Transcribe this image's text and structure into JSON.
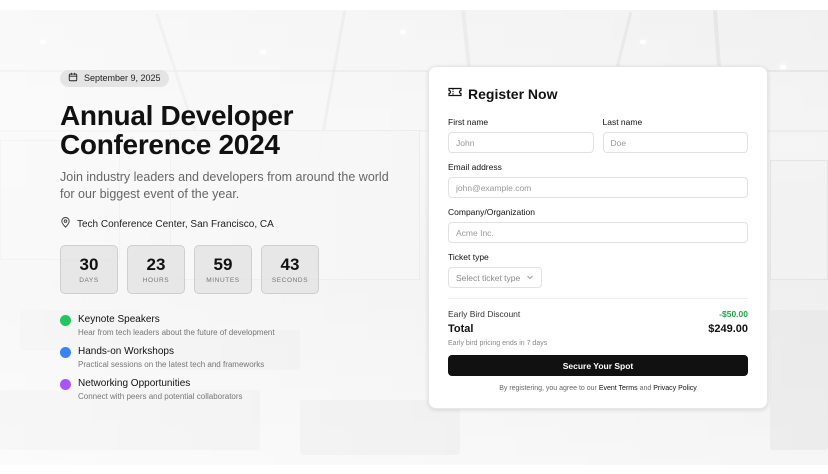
{
  "event": {
    "date": "September 9, 2025",
    "title_line1": "Annual Developer",
    "title_line2": "Conference 2024",
    "subtitle": "Join industry leaders and developers from around the world for our biggest event of the year.",
    "location": "Tech Conference Center, San Francisco, CA"
  },
  "countdown": [
    {
      "value": "30",
      "label": "DAYS"
    },
    {
      "value": "23",
      "label": "HOURS"
    },
    {
      "value": "59",
      "label": "MINUTES"
    },
    {
      "value": "43",
      "label": "SECONDS"
    }
  ],
  "features": [
    {
      "title": "Keynote Speakers",
      "desc": "Hear from tech leaders about the future of development",
      "color": "#22c55e"
    },
    {
      "title": "Hands-on Workshops",
      "desc": "Practical sessions on the latest tech and frameworks",
      "color": "#3b82f6"
    },
    {
      "title": "Networking Opportunities",
      "desc": "Connect with peers and potential collaborators",
      "color": "#a855f7"
    }
  ],
  "form": {
    "title": "Register Now",
    "first_name": {
      "label": "First name",
      "placeholder": "John",
      "value": ""
    },
    "last_name": {
      "label": "Last name",
      "placeholder": "Doe",
      "value": ""
    },
    "email": {
      "label": "Email address",
      "placeholder": "john@example.com",
      "value": ""
    },
    "company": {
      "label": "Company/Organization",
      "placeholder": "Acme Inc.",
      "value": ""
    },
    "ticket": {
      "label": "Ticket type",
      "placeholder": "Select ticket type"
    },
    "discount_label": "Early Bird Discount",
    "discount_value": "-$50.00",
    "total_label": "Total",
    "total_value": "$249.00",
    "note": "Early bird pricing ends in 7 days",
    "submit": "Secure Your Spot",
    "terms_prefix": "By registering, you agree to our",
    "terms_link": "Event Terms",
    "terms_and": "and",
    "privacy_link": "Privacy Policy"
  },
  "icons": {
    "date": "calendar-icon",
    "location": "map-pin-icon",
    "form": "ticket-icon",
    "select": "chevron-down-icon"
  }
}
